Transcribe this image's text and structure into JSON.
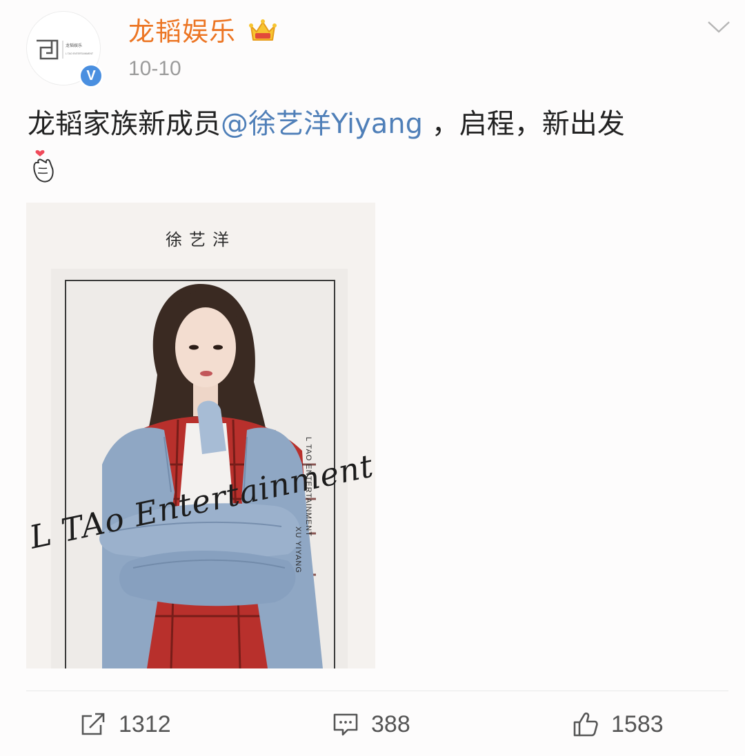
{
  "post": {
    "author": "龙韬娱乐",
    "date": "10-10",
    "text_before": "龙韬家族新成员",
    "mention": "@徐艺洋Yiyang",
    "text_after": " ，启程，新出发",
    "colors": {
      "author": "#ec7523",
      "mention": "#4f7fb8",
      "verified": "#4a8fe0"
    },
    "icons": {
      "avatar": "ltao-logo-icon",
      "verified": "verified-icon",
      "crown": "crown-icon",
      "menu": "chevron-down-icon",
      "emoji": "finger-heart-icon"
    }
  },
  "avatar": {
    "logo_text": "龙韬娱乐",
    "logo_subtext": "L TAO ENTERTAINMENT",
    "verified_mark": "V"
  },
  "photo": {
    "title": "徐艺洋",
    "side_text_1": "L TAO ENTERTAINMENT",
    "side_text_2": "XU YIYANG",
    "script_text": "L TAo Entertainment"
  },
  "actions": {
    "repost": {
      "icon": "share-icon",
      "count": "1312"
    },
    "comment": {
      "icon": "comment-icon",
      "count": "388"
    },
    "like": {
      "icon": "thumbs-up-icon",
      "count": "1583"
    }
  }
}
